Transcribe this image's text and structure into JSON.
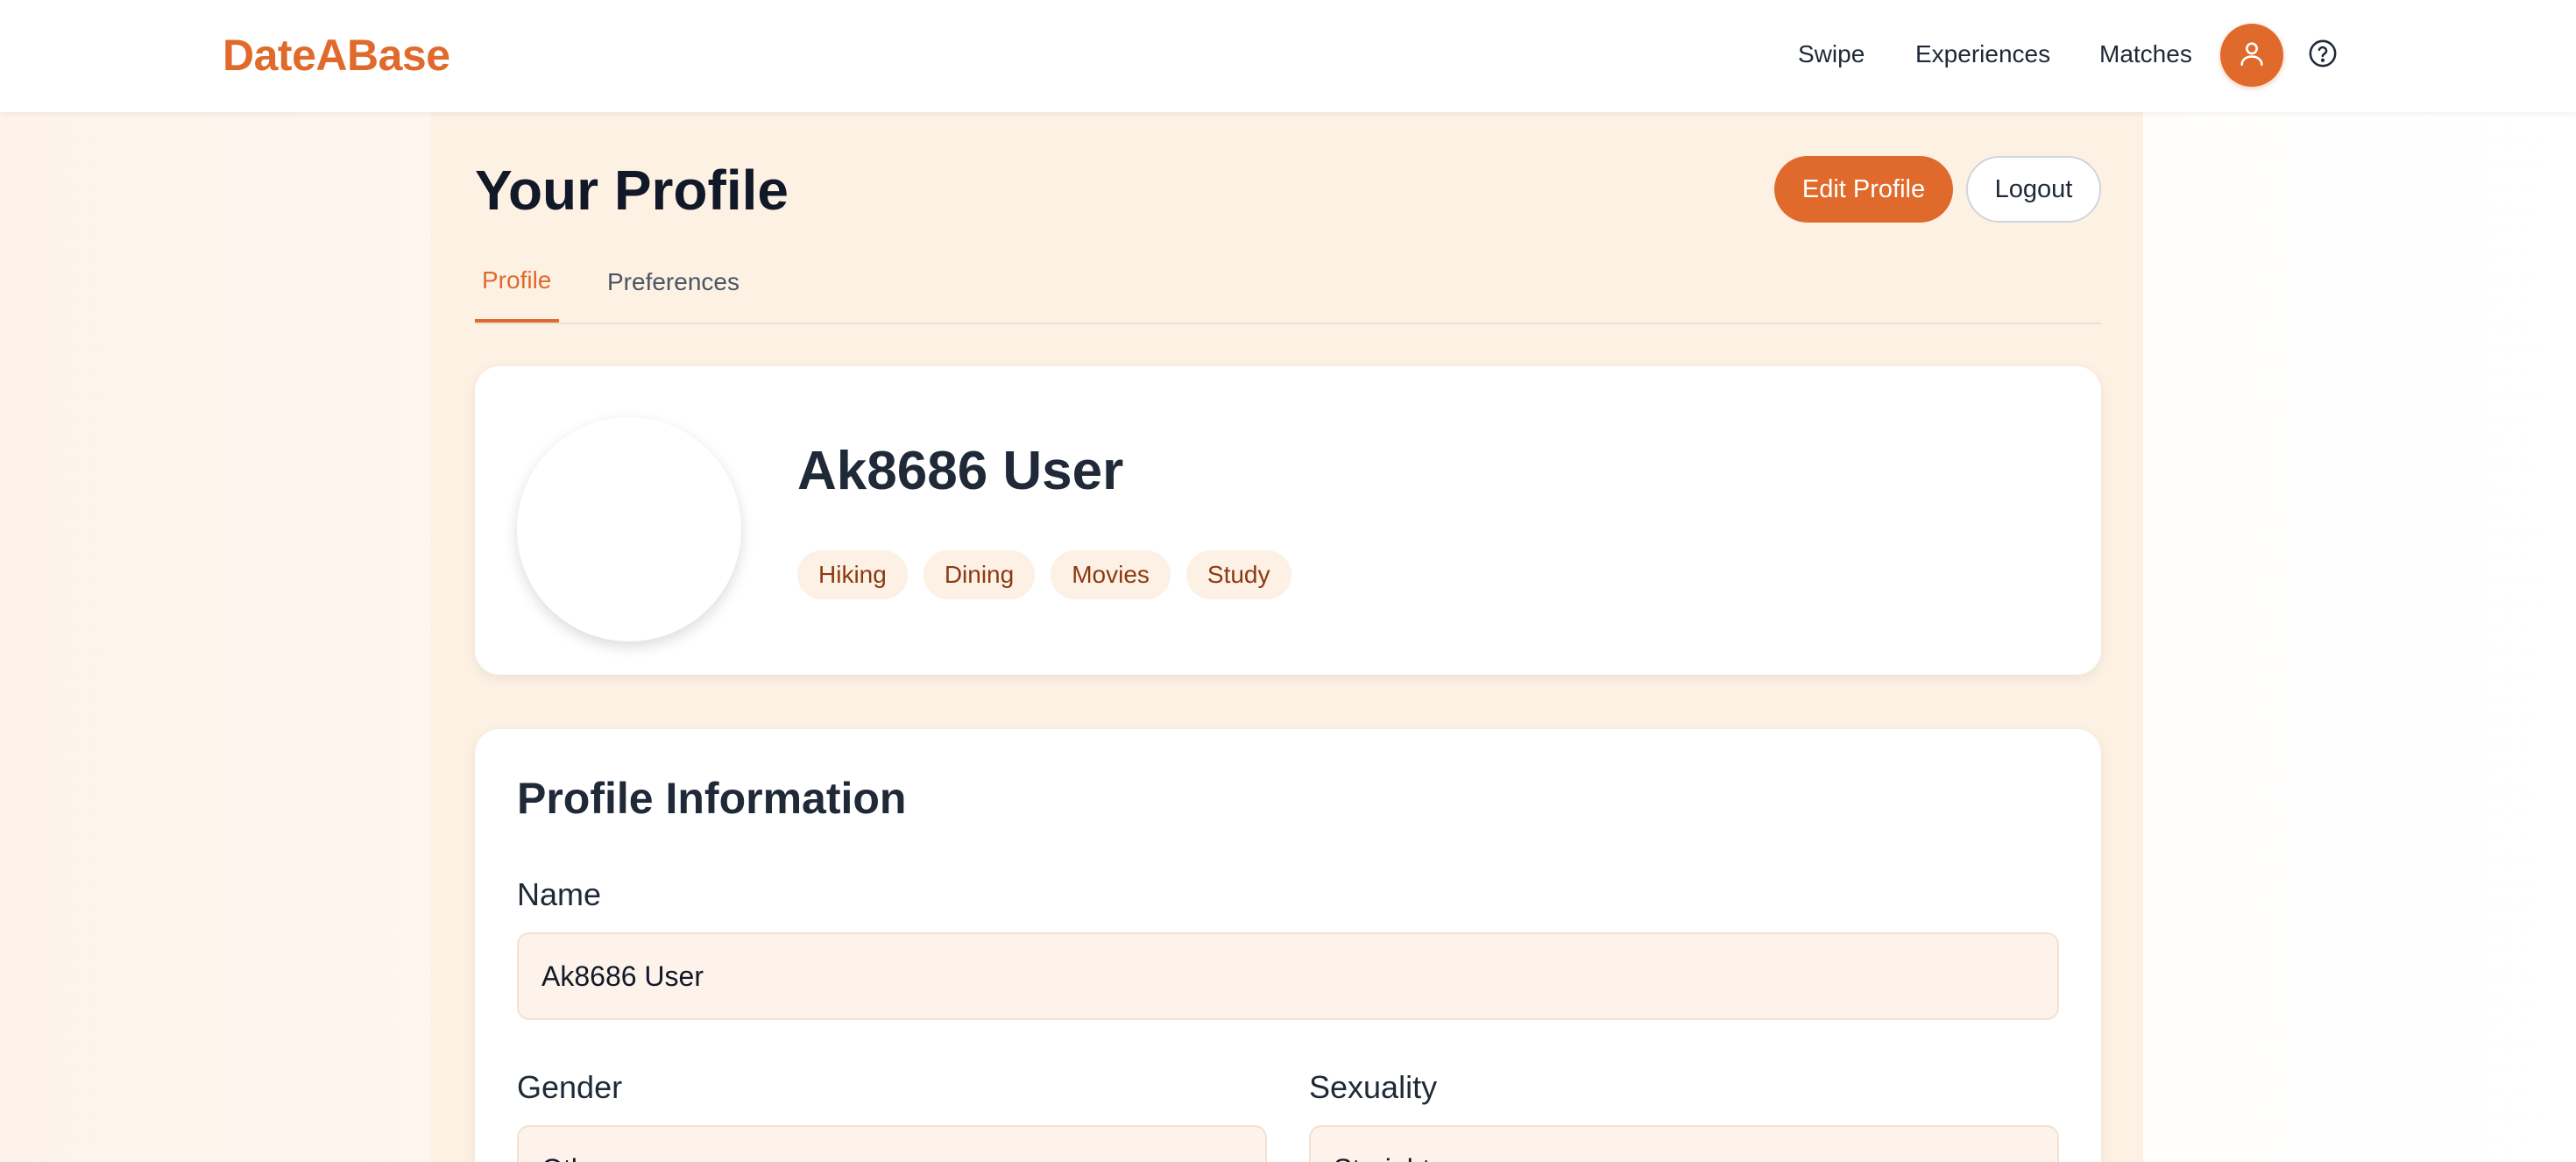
{
  "brand": {
    "name": "DateABase",
    "accent": "#e06a2c"
  },
  "nav": {
    "items": [
      {
        "label": "Swipe"
      },
      {
        "label": "Experiences"
      },
      {
        "label": "Matches"
      }
    ],
    "avatar_icon": "user-icon",
    "help_icon": "help-circle-icon"
  },
  "page": {
    "title": "Your Profile",
    "edit_label": "Edit Profile",
    "logout_label": "Logout",
    "tabs": [
      {
        "label": "Profile",
        "active": true
      },
      {
        "label": "Preferences",
        "active": false
      }
    ]
  },
  "profile": {
    "name": "Ak8686 User",
    "interests": [
      "Hiking",
      "Dining",
      "Movies",
      "Study"
    ]
  },
  "info": {
    "title": "Profile Information",
    "name_label": "Name",
    "name_value": "Ak8686 User",
    "gender_label": "Gender",
    "gender_value": "Other",
    "sexuality_label": "Sexuality",
    "sexuality_value": "Straight"
  }
}
